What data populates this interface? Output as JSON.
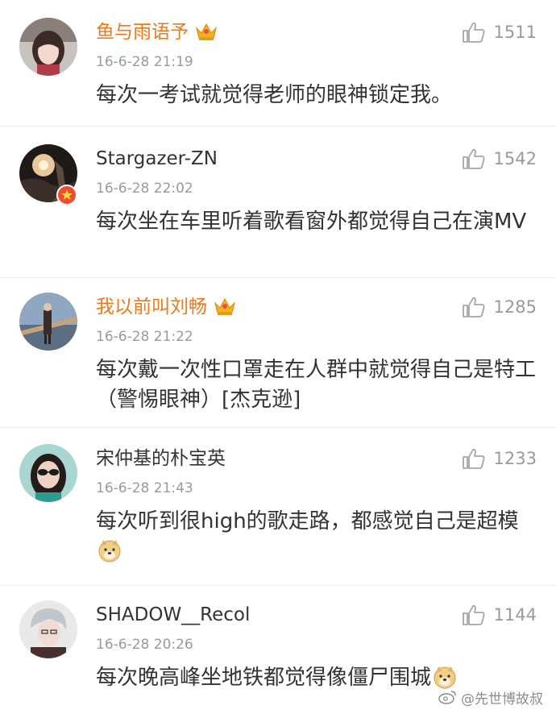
{
  "comments": [
    {
      "username": "鱼与雨语予",
      "vip": true,
      "time": "16-6-28 21:19",
      "text": "每次一考试就觉得老师的眼神锁定我。",
      "likes": "1511",
      "avatar_icon": "avatar-girl-icon"
    },
    {
      "username": "Stargazer-ZN",
      "vip": false,
      "verified": true,
      "time": "16-6-28 22:02",
      "text": "每次坐在车里听着歌看窗外都觉得自己在演MV",
      "likes": "1542",
      "avatar_icon": "avatar-sunset-icon"
    },
    {
      "username": "我以前叫刘畅",
      "vip": true,
      "time": "16-6-28 21:22",
      "text": "每次戴一次性口罩走在人群中就觉得自己是特工（警惕眼神）[杰克逊]",
      "likes": "1285",
      "avatar_icon": "avatar-bridge-icon"
    },
    {
      "username": "宋仲基的朴宝英",
      "vip": false,
      "time": "16-6-28 21:43",
      "text": "每次听到很high的歌走路，都感觉自己是超模",
      "likes": "1233",
      "avatar_icon": "avatar-sunglasses-icon",
      "emoji": "doge-emoji-icon"
    },
    {
      "username": "SHADOW__Recol",
      "vip": false,
      "time": "16-6-28 20:26",
      "text": "每次晚高峰坐地铁都觉得像僵尸围城",
      "likes": "1144",
      "avatar_icon": "avatar-boy-icon",
      "emoji": "doge-emoji-icon"
    }
  ],
  "watermark": "@先世博故叔",
  "colors": {
    "vip_name": "#ec7a1a",
    "text": "#333333",
    "meta": "#9a9a9a",
    "divider": "#ececec",
    "verified_badge": "#f24a2c"
  }
}
